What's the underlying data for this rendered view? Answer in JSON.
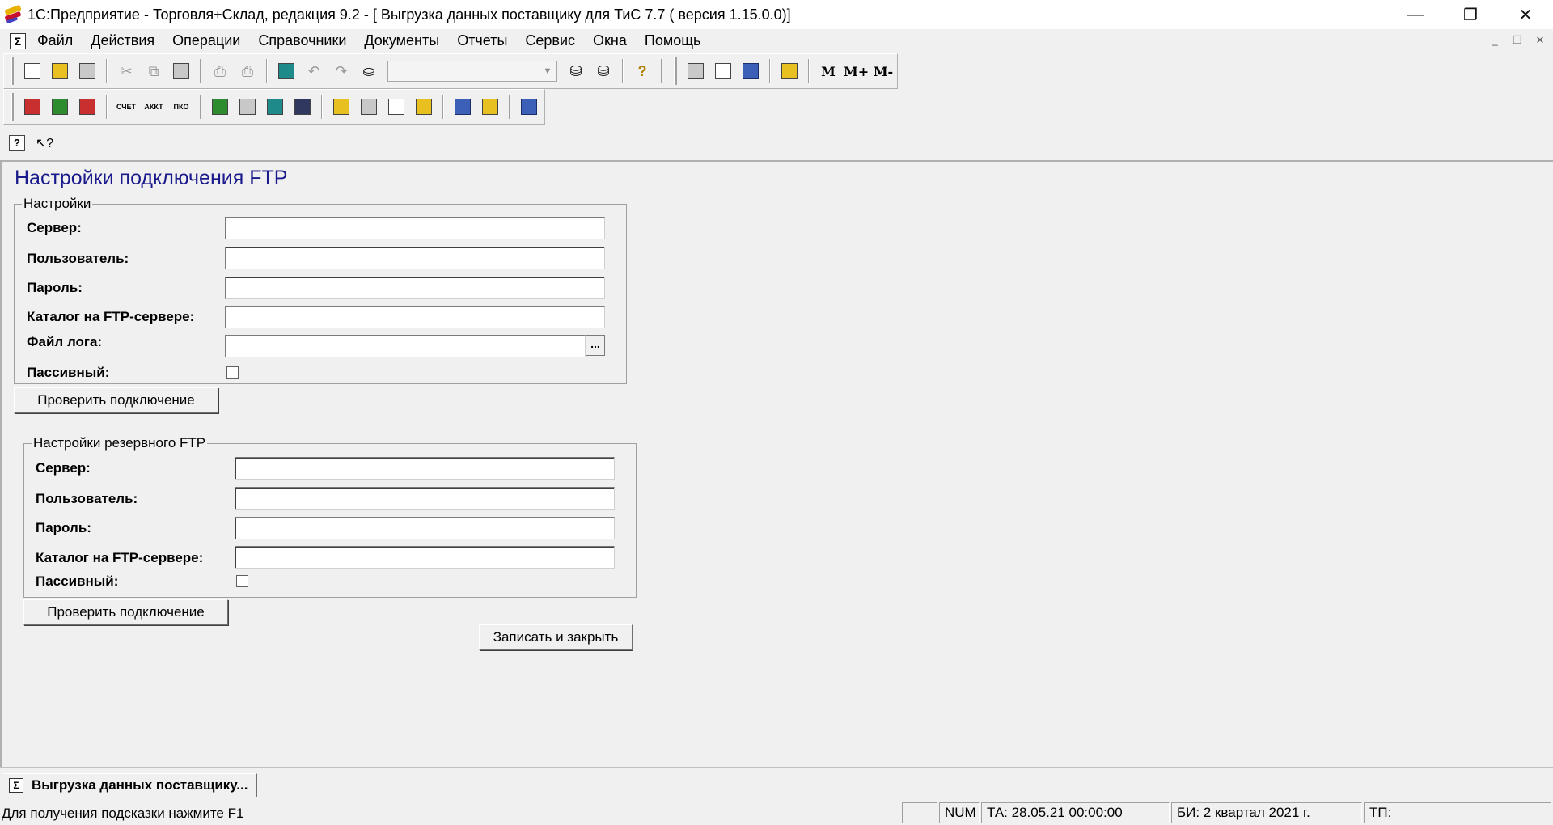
{
  "window": {
    "title": "1С:Предприятие - Торговля+Склад, редакция 9.2 - [ Выгрузка данных поставщику для ТиС 7.7 ( версия 1.15.0.0)]",
    "minimize": "—",
    "restore": "❐",
    "close": "✕"
  },
  "menu": {
    "sys_icon": "Σ",
    "items": [
      "Файл",
      "Действия",
      "Операции",
      "Справочники",
      "Документы",
      "Отчеты",
      "Сервис",
      "Окна",
      "Помощь"
    ],
    "mdi_minimize": "_",
    "mdi_restore": "❐",
    "mdi_close": "✕"
  },
  "toolbar1": {
    "letters": [
      "M",
      "M+",
      "M-"
    ]
  },
  "toolbar2": {
    "labels": [
      "СЧЕТ",
      "АККТ",
      "ПКО"
    ]
  },
  "form": {
    "title": "Настройки подключения FTP",
    "main_group": {
      "legend": "Настройки",
      "server_label": "Сервер:",
      "user_label": "Пользователь:",
      "password_label": "Пароль:",
      "catalog_label": "Каталог на FTP-сервере:",
      "logfile_label": "Файл лога:",
      "passive_label": "Пассивный:",
      "server_value": "",
      "user_value": "",
      "password_value": "",
      "catalog_value": "",
      "logfile_value": "",
      "browse_label": "..."
    },
    "check_button_label": "Проверить подключение",
    "backup_group": {
      "legend": "Настройки резервного FTP",
      "server_label": "Сервер:",
      "user_label": "Пользователь:",
      "password_label": "Пароль:",
      "catalog_label": "Каталог на FTP-сервере:",
      "passive_label": "Пассивный:",
      "server_value": "",
      "user_value": "",
      "password_value": "",
      "catalog_value": ""
    },
    "backup_check_button_label": "Проверить подключение",
    "save_close_label": "Записать и закрыть"
  },
  "window_tabs": {
    "active_icon": "Σ",
    "active_label": "Выгрузка данных поставщику..."
  },
  "status": {
    "hint": "Для получения подсказки нажмите F1",
    "num": "NUM",
    "ta": "ТА: 28.05.21  00:00:00",
    "bi": "БИ: 2 квартал 2021 г.",
    "tp": "ТП:"
  }
}
